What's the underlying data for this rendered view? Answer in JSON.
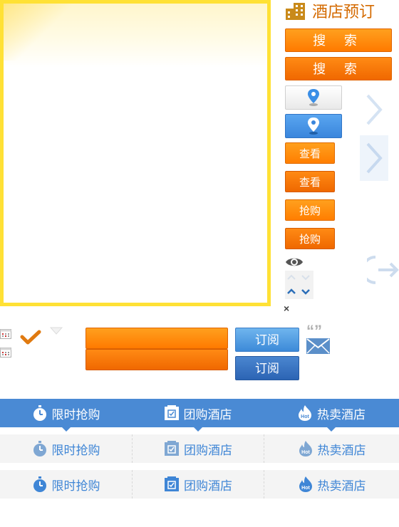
{
  "title": "酒店预订",
  "search_buttons": [
    "搜 索",
    "搜 索"
  ],
  "view_buttons": [
    "查看",
    "查看"
  ],
  "buy_buttons": [
    "抢购",
    "抢购"
  ],
  "close_symbol": "×",
  "subscribe_buttons": [
    "订阅",
    "订阅"
  ],
  "quote_symbol": "“”",
  "tabs": [
    "限时抢购",
    "团购酒店",
    "热卖酒店"
  ],
  "hot_badge": "Hot",
  "colors": {
    "panel_border": "#ffe135",
    "orange": "#ff7a00",
    "blue_bar": "#4a8ad4",
    "tab_text_blue": "#3f86d6",
    "title_orange": "#d46a00"
  },
  "icons": [
    "hotel-icon",
    "location-pin-icon",
    "chevron-right-icon",
    "exit-arrow-icon",
    "eye-icon",
    "chevron-up-icon",
    "chevron-down-icon",
    "calendar-icon",
    "checkmark-icon",
    "triangle-down-icon",
    "mail-icon",
    "clock-icon",
    "coupon-icon",
    "hot-flame-icon"
  ]
}
